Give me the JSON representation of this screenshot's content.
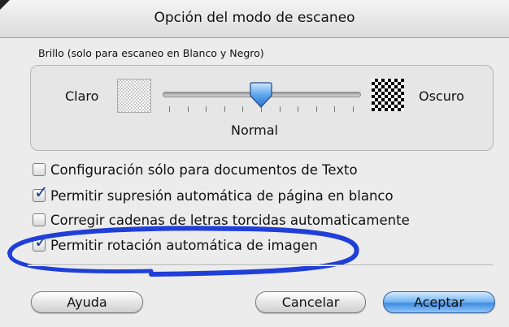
{
  "window": {
    "title": "Opción del modo de escaneo"
  },
  "brightness": {
    "group_label": "Brillo (solo para escaneo en Blanco y Negro)",
    "left_label": "Claro",
    "right_label": "Oscuro",
    "value_label": "Normal",
    "level": 0.5,
    "tick_count": 11
  },
  "options": [
    {
      "label": "Configuración sólo para documentos de Texto",
      "checked": false
    },
    {
      "label": "Permitir supresión automática de página en blanco",
      "checked": true
    },
    {
      "label": "Corregir cadenas de letras torcidas automaticamente",
      "checked": false
    },
    {
      "label": "Permitir rotación automática de imagen",
      "checked": true
    }
  ],
  "buttons": {
    "help": "Ayuda",
    "cancel": "Cancelar",
    "ok": "Aceptar"
  },
  "colors": {
    "accent": "#3d8be2",
    "highlight_ellipse": "#1f3fd8",
    "checkmark": "#143f8c"
  },
  "icons": {
    "light": "light-pattern-icon",
    "dark": "dark-pattern-icon",
    "slider_thumb": "slider-thumb-icon"
  }
}
